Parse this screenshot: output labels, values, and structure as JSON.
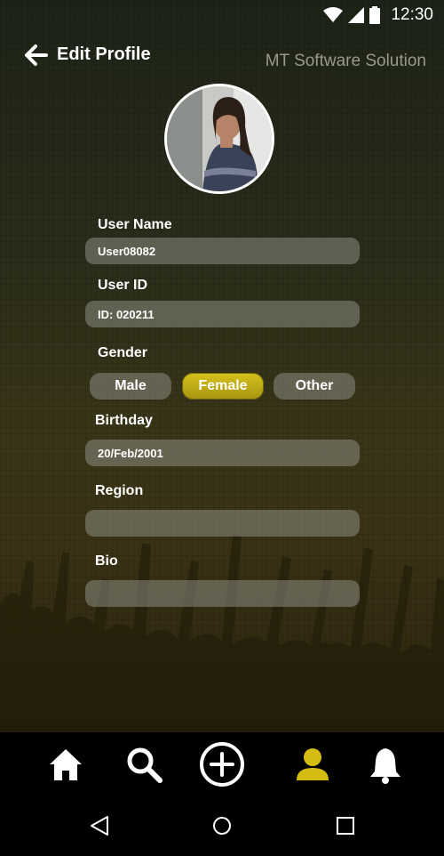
{
  "status_bar": {
    "time": "12:30"
  },
  "header": {
    "title": "Edit Profile",
    "brand": "MT Software Solution"
  },
  "form": {
    "username": {
      "label": "User Name",
      "value": "User08082"
    },
    "userid": {
      "label": "User ID",
      "value": "ID: 020211"
    },
    "gender": {
      "label": "Gender",
      "options": [
        "Male",
        "Female",
        "Other"
      ],
      "selected": "Female"
    },
    "birthday": {
      "label": "Birthday",
      "value": "20/Feb/2001"
    },
    "region": {
      "label": "Region",
      "value": ""
    },
    "bio": {
      "label": "Bio",
      "value": ""
    }
  },
  "bottom_nav": {
    "items": [
      "home-icon",
      "search-icon",
      "add-icon",
      "profile-icon",
      "bell-icon"
    ],
    "active": "profile-icon",
    "active_color": "#d4bd10"
  },
  "colors": {
    "accent": "#d4bd10",
    "field_bg": "#6b6b60"
  }
}
